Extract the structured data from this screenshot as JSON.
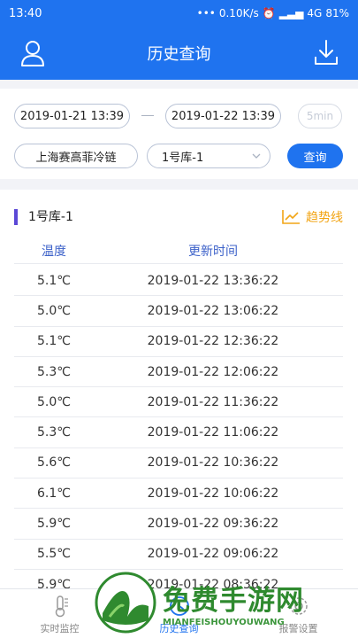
{
  "status_bar": {
    "time": "13:40",
    "speed": "0.10K/s",
    "network": "4G",
    "battery": "81%"
  },
  "app_bar": {
    "title": "历史查询"
  },
  "filter": {
    "start_datetime": "2019-01-21 13:39",
    "end_datetime": "2019-01-22 13:39",
    "interval": "5min",
    "company": "上海赛高菲冷链",
    "warehouse": "1号库-1",
    "query_label": "查询"
  },
  "section": {
    "title": "1号库-1",
    "trend_label": "趋势线"
  },
  "table": {
    "headers": [
      "温度",
      "更新时间"
    ],
    "rows": [
      {
        "temp": "5.1℃",
        "time": "2019-01-22 13:36:22"
      },
      {
        "temp": "5.0℃",
        "time": "2019-01-22 13:06:22"
      },
      {
        "temp": "5.1℃",
        "time": "2019-01-22 12:36:22"
      },
      {
        "temp": "5.3℃",
        "time": "2019-01-22 12:06:22"
      },
      {
        "temp": "5.0℃",
        "time": "2019-01-22 11:36:22"
      },
      {
        "temp": "5.3℃",
        "time": "2019-01-22 11:06:22"
      },
      {
        "temp": "5.6℃",
        "time": "2019-01-22 10:36:22"
      },
      {
        "temp": "6.1℃",
        "time": "2019-01-22 10:06:22"
      },
      {
        "temp": "5.9℃",
        "time": "2019-01-22 09:36:22"
      },
      {
        "temp": "5.5℃",
        "time": "2019-01-22 09:06:22"
      },
      {
        "temp": "5.9℃",
        "time": "2019-01-22 08:36:22"
      }
    ]
  },
  "tabs": [
    {
      "label": "实时监控",
      "icon": "thermometer-icon",
      "active": false
    },
    {
      "label": "历史查询",
      "icon": "history-icon",
      "active": true
    },
    {
      "label": "报警设置",
      "icon": "settings-icon",
      "active": false
    }
  ],
  "watermark": {
    "title": "免费手游网",
    "subtitle": "MIANFEISHOUYOUWANG"
  },
  "colors": {
    "primary": "#1f73ef",
    "accent": "#f2a516",
    "section_bar": "#5b48d6",
    "watermark": "#2f8a2f"
  }
}
